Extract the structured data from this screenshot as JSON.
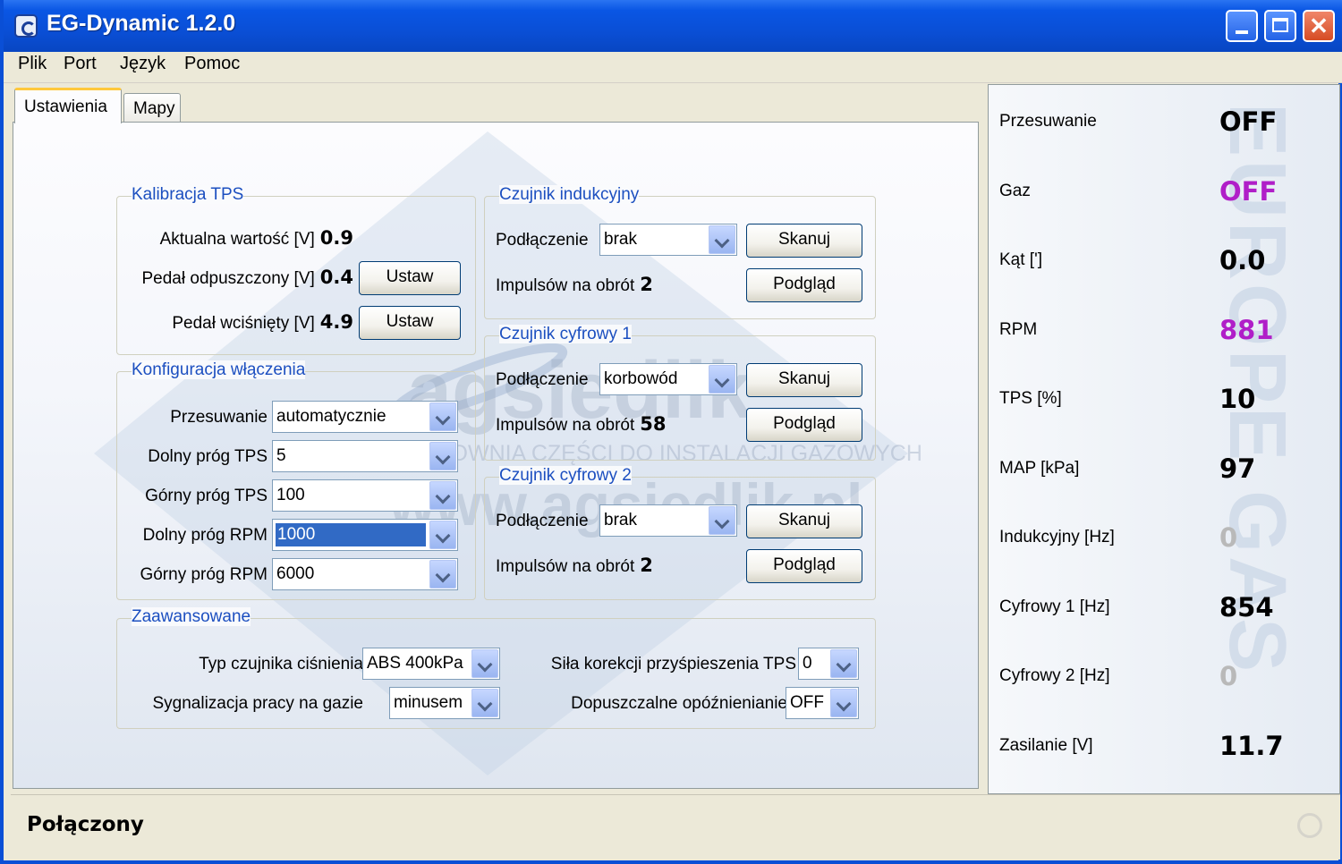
{
  "window": {
    "title": "EG-Dynamic 1.2.0"
  },
  "menu": [
    "Plik",
    "Port",
    "Język",
    "Pomoc"
  ],
  "tabs": [
    "Ustawienia",
    "Mapy"
  ],
  "watermark": {
    "brand": "agsiedlik",
    "tagline": "HURTOWNIA CZĘŚCI DO INSTALACJI GAZOWYCH",
    "url": "www.agsiedlik.pl"
  },
  "kalibracja": {
    "title": "Kalibracja TPS",
    "aktualna_label": "Aktualna wartość [V]",
    "aktualna_value": "0.9",
    "odpuszczony_label": "Pedał odpuszczony [V]",
    "odpuszczony_value": "0.4",
    "wcisniety_label": "Pedał wciśnięty [V]",
    "wcisniety_value": "4.9",
    "ustaw": "Ustaw"
  },
  "konfiguracja": {
    "title": "Konfiguracja włączenia",
    "rows": [
      {
        "label": "Przesuwanie",
        "value": "automatycznie"
      },
      {
        "label": "Dolny próg TPS",
        "value": "5"
      },
      {
        "label": "Górny próg TPS",
        "value": "100"
      },
      {
        "label": "Dolny próg RPM",
        "value": "1000"
      },
      {
        "label": "Górny próg RPM",
        "value": "6000"
      }
    ]
  },
  "czujniki": [
    {
      "title": "Czujnik indukcyjny",
      "podlaczenie_label": "Podłączenie",
      "podlaczenie": "brak",
      "impulsy_label": "Impulsów na obrót",
      "impulsy": "2",
      "skanuj": "Skanuj",
      "podglad": "Podgląd"
    },
    {
      "title": "Czujnik cyfrowy 1",
      "podlaczenie_label": "Podłączenie",
      "podlaczenie": "korbowód",
      "impulsy_label": "Impulsów na obrót",
      "impulsy": "58",
      "skanuj": "Skanuj",
      "podglad": "Podgląd"
    },
    {
      "title": "Czujnik cyfrowy 2",
      "podlaczenie_label": "Podłączenie",
      "podlaczenie": "brak",
      "impulsy_label": "Impulsów na obrót",
      "impulsy": "2",
      "skanuj": "Skanuj",
      "podglad": "Podgląd"
    }
  ],
  "zaawansowane": {
    "title": "Zaawansowane",
    "typ_label": "Typ czujnika ciśnienia",
    "typ_value": "ABS 400kPa",
    "sygn_label": "Sygnalizacja pracy na gazie",
    "sygn_value": "minusem",
    "sila_label": "Siła korekcji przyśpieszenia TPS",
    "sila_value": "0",
    "opozn_label": "Dopuszczalne opóźnienianie",
    "opozn_value": "OFF"
  },
  "side_watermark": "EUROPE GAS",
  "readouts": [
    {
      "label": "Przesuwanie",
      "value": "OFF",
      "color": "#000000"
    },
    {
      "label": "Gaz",
      "value": "OFF",
      "color": "#b01ec8"
    },
    {
      "label": "Kąt [']",
      "value": "0.0",
      "color": "#000000"
    },
    {
      "label": "RPM",
      "value": "881",
      "color": "#b01ec8"
    },
    {
      "label": "TPS [%]",
      "value": "10",
      "color": "#000000"
    },
    {
      "label": "MAP [kPa]",
      "value": "97",
      "color": "#000000"
    },
    {
      "label": "Indukcyjny [Hz]",
      "value": "0",
      "color": "#b9b9b9"
    },
    {
      "label": "Cyfrowy 1 [Hz]",
      "value": "854",
      "color": "#000000"
    },
    {
      "label": "Cyfrowy 2 [Hz]",
      "value": "0",
      "color": "#b9b9b9"
    },
    {
      "label": "Zasilanie [V]",
      "value": "11.7",
      "color": "#000000"
    }
  ],
  "status": "Połączony"
}
